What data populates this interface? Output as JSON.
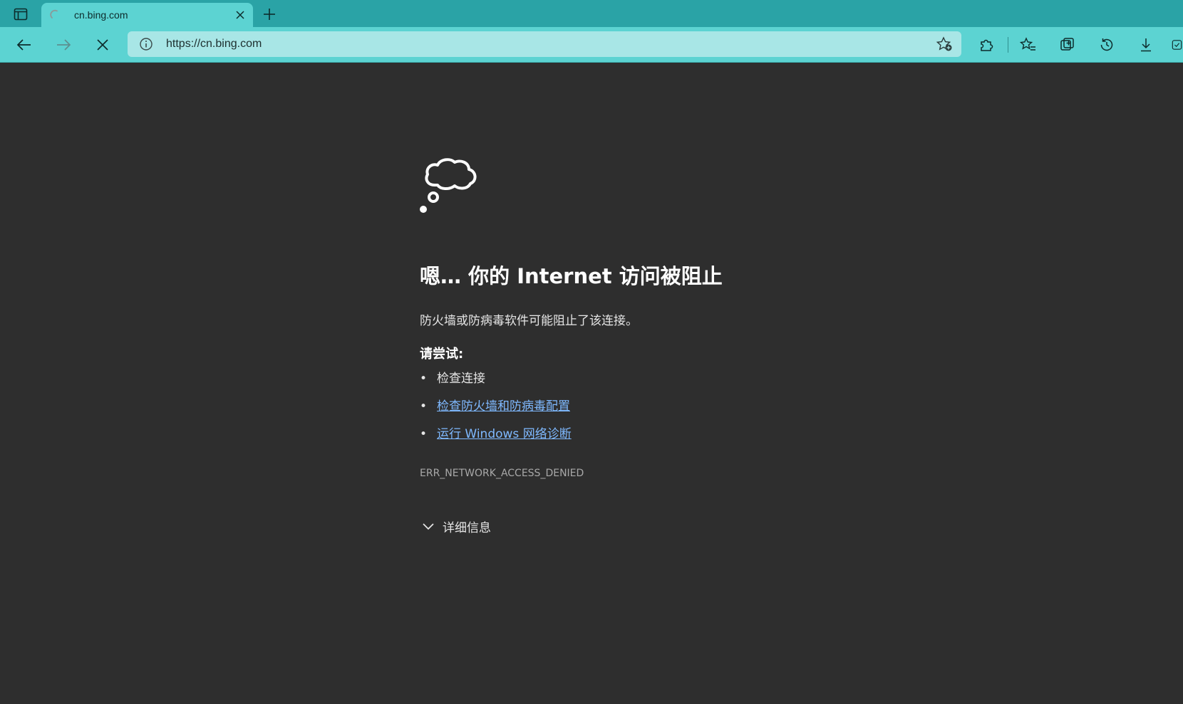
{
  "browser": {
    "tab": {
      "title": "cn.bing.com"
    },
    "address_bar": {
      "url": "https://cn.bing.com"
    },
    "colors": {
      "tabstrip": "#2aa3a6",
      "toolbar": "#5cd3d2",
      "address_bar": "#a8e6e6"
    }
  },
  "error_page": {
    "title": "嗯… 你的 Internet 访问被阻止",
    "description": "防火墙或防病毒软件可能阻止了该连接。",
    "try_heading": "请尝试:",
    "bullet": "•",
    "suggestions": [
      {
        "label": "检查连接",
        "is_link": false
      },
      {
        "label": "检查防火墙和防病毒配置",
        "is_link": true
      },
      {
        "label": "运行 Windows 网络诊断",
        "is_link": true
      }
    ],
    "error_code": "ERR_NETWORK_ACCESS_DENIED",
    "details_label": "详细信息",
    "colors": {
      "background": "#2e2e2e",
      "link": "#7fb9ff"
    }
  }
}
